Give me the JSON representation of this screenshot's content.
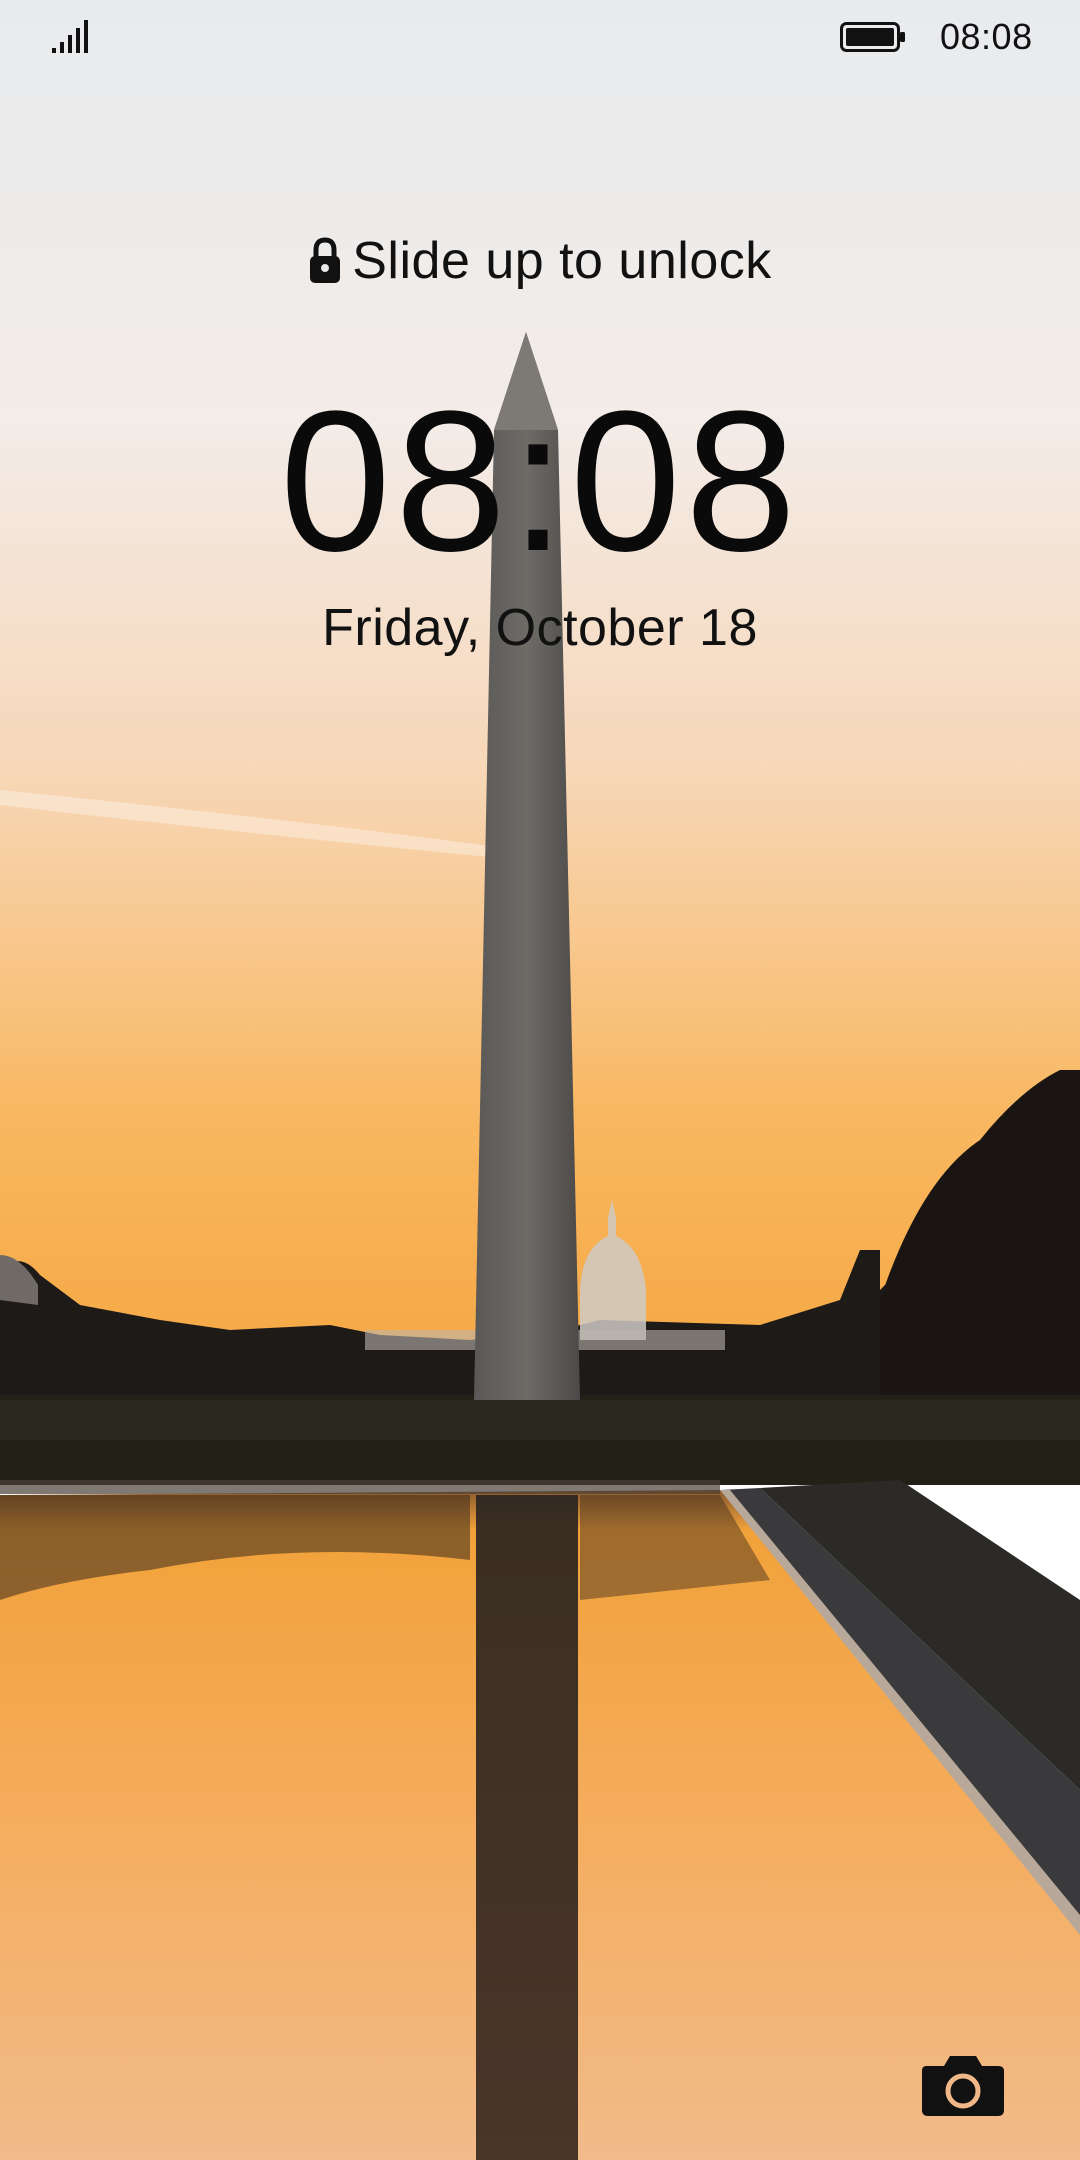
{
  "status_bar": {
    "time": "08:08",
    "signal_icon": "signal-bars-icon",
    "battery_icon": "battery-full-icon"
  },
  "lockscreen": {
    "unlock_hint": "Slide up to unlock",
    "lock_icon": "lock-icon",
    "clock": "08:08",
    "date": "Friday, October 18",
    "camera_shortcut_icon": "camera-icon"
  },
  "wallpaper": {
    "description_icon": "wallpaper-image",
    "sky_top_color": "#e9ecef",
    "sky_bottom_color": "#f7a646",
    "water_color": "#f2a24a"
  }
}
